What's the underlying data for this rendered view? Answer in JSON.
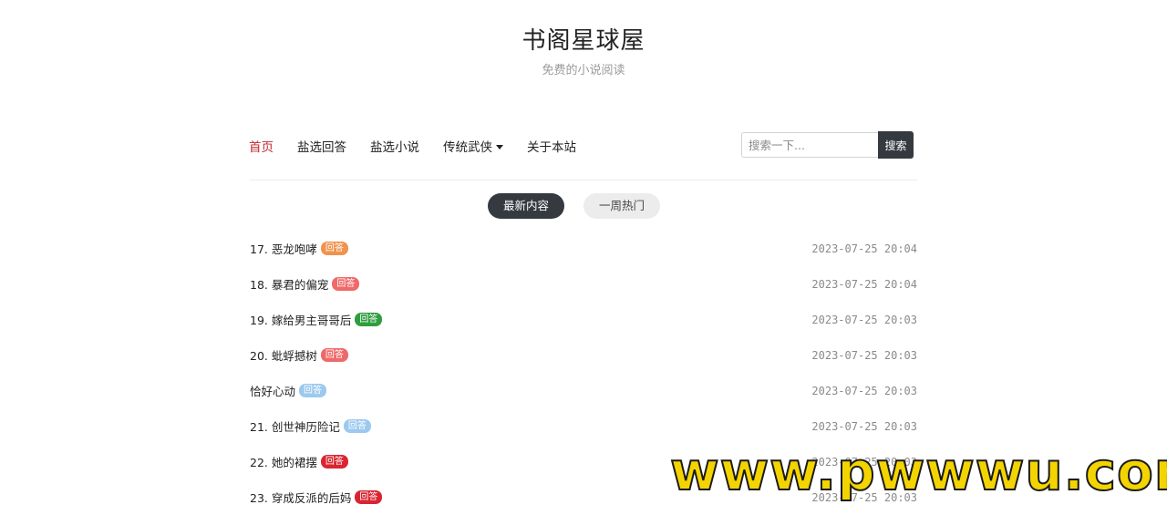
{
  "site": {
    "title": "书阁星球屋",
    "subtitle": "免费的小说阅读"
  },
  "nav": {
    "items": [
      {
        "label": "首页",
        "active": true
      },
      {
        "label": "盐选回答"
      },
      {
        "label": "盐选小说"
      },
      {
        "label": "传统武侠",
        "dropdown": true
      },
      {
        "label": "关于本站"
      }
    ]
  },
  "search": {
    "placeholder": "搜索一下...",
    "button_label": "搜索"
  },
  "tabs": [
    {
      "label": "最新内容",
      "active": true
    },
    {
      "label": "一周热门",
      "active": false
    }
  ],
  "list": [
    {
      "title": "17. 恶龙咆哮",
      "badge": "回答",
      "badge_color": "#f0934e",
      "date": "2023-07-25 20:04"
    },
    {
      "title": "18. 暴君的偏宠",
      "badge": "回答",
      "badge_color": "#f0696a",
      "date": "2023-07-25 20:04"
    },
    {
      "title": "19. 嫁给男主哥哥后",
      "badge": "回答",
      "badge_color": "#2e9e3e",
      "date": "2023-07-25 20:03"
    },
    {
      "title": "20. 蚍蜉撼树",
      "badge": "回答",
      "badge_color": "#f0696a",
      "date": "2023-07-25 20:03"
    },
    {
      "title": "恰好心动",
      "badge": "回答",
      "badge_color": "#9cc9ef",
      "date": "2023-07-25 20:03"
    },
    {
      "title": "21. 创世神历险记",
      "badge": "回答",
      "badge_color": "#9cc9ef",
      "date": "2023-07-25 20:03"
    },
    {
      "title": "22. 她的裙摆",
      "badge": "回答",
      "badge_color": "#d92532",
      "date": "2023-07-25 20:03"
    },
    {
      "title": "23. 穿成反派的后妈",
      "badge": "回答",
      "badge_color": "#d92532",
      "date": "2023-07-25 20:03"
    }
  ],
  "watermark": "www.pwwwu.com"
}
